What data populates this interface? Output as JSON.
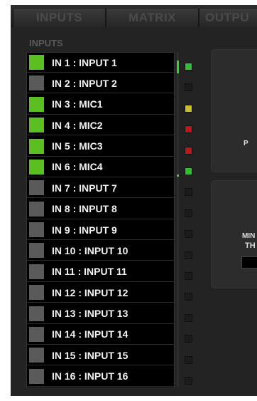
{
  "tabs": [
    "INPUTS",
    "MATRIX",
    "OUTPU"
  ],
  "section_label": "INPUTS",
  "inputs": [
    {
      "label": "IN 1 : INPUT 1",
      "on": true
    },
    {
      "label": "IN 2 : INPUT 2",
      "on": false
    },
    {
      "label": "IN 3 : MIC1",
      "on": true
    },
    {
      "label": "IN 4 : MIC2",
      "on": true
    },
    {
      "label": "IN 5 : MIC3",
      "on": true
    },
    {
      "label": "IN 6 : MIC4",
      "on": true
    },
    {
      "label": "IN 7 : INPUT 7",
      "on": false
    },
    {
      "label": "IN 8 : INPUT 8",
      "on": false
    },
    {
      "label": "IN 9 : INPUT 9",
      "on": false
    },
    {
      "label": "IN 10 : INPUT 10",
      "on": false
    },
    {
      "label": "IN 11 : INPUT 11",
      "on": false
    },
    {
      "label": "IN 12 : INPUT 12",
      "on": false
    },
    {
      "label": "IN 13 : INPUT 13",
      "on": false
    },
    {
      "label": "IN 14 : INPUT 14",
      "on": false
    },
    {
      "label": "IN 15 : INPUT 15",
      "on": false
    },
    {
      "label": "IN 16 : INPUT 16",
      "on": false
    }
  ],
  "leds": [
    "#2fbf2f",
    "#1c1c1c",
    "#c9c02c",
    "#b81a1a",
    "#b81a1a",
    "#2fbf2f",
    "#1c1c1c",
    "#1c1c1c",
    "#1c1c1c",
    "#1c1c1c",
    "#1c1c1c",
    "#1c1c1c",
    "#1c1c1c",
    "#1c1c1c",
    "#1c1c1c",
    "#1c1c1c"
  ],
  "colors": {
    "swatch_on": "#5bbf22",
    "swatch_off": "#5a5a5a",
    "level": "#38d238"
  },
  "panel_top_text": "P",
  "panel_bottom_text_1": "MIN",
  "panel_bottom_text_2": "TH"
}
